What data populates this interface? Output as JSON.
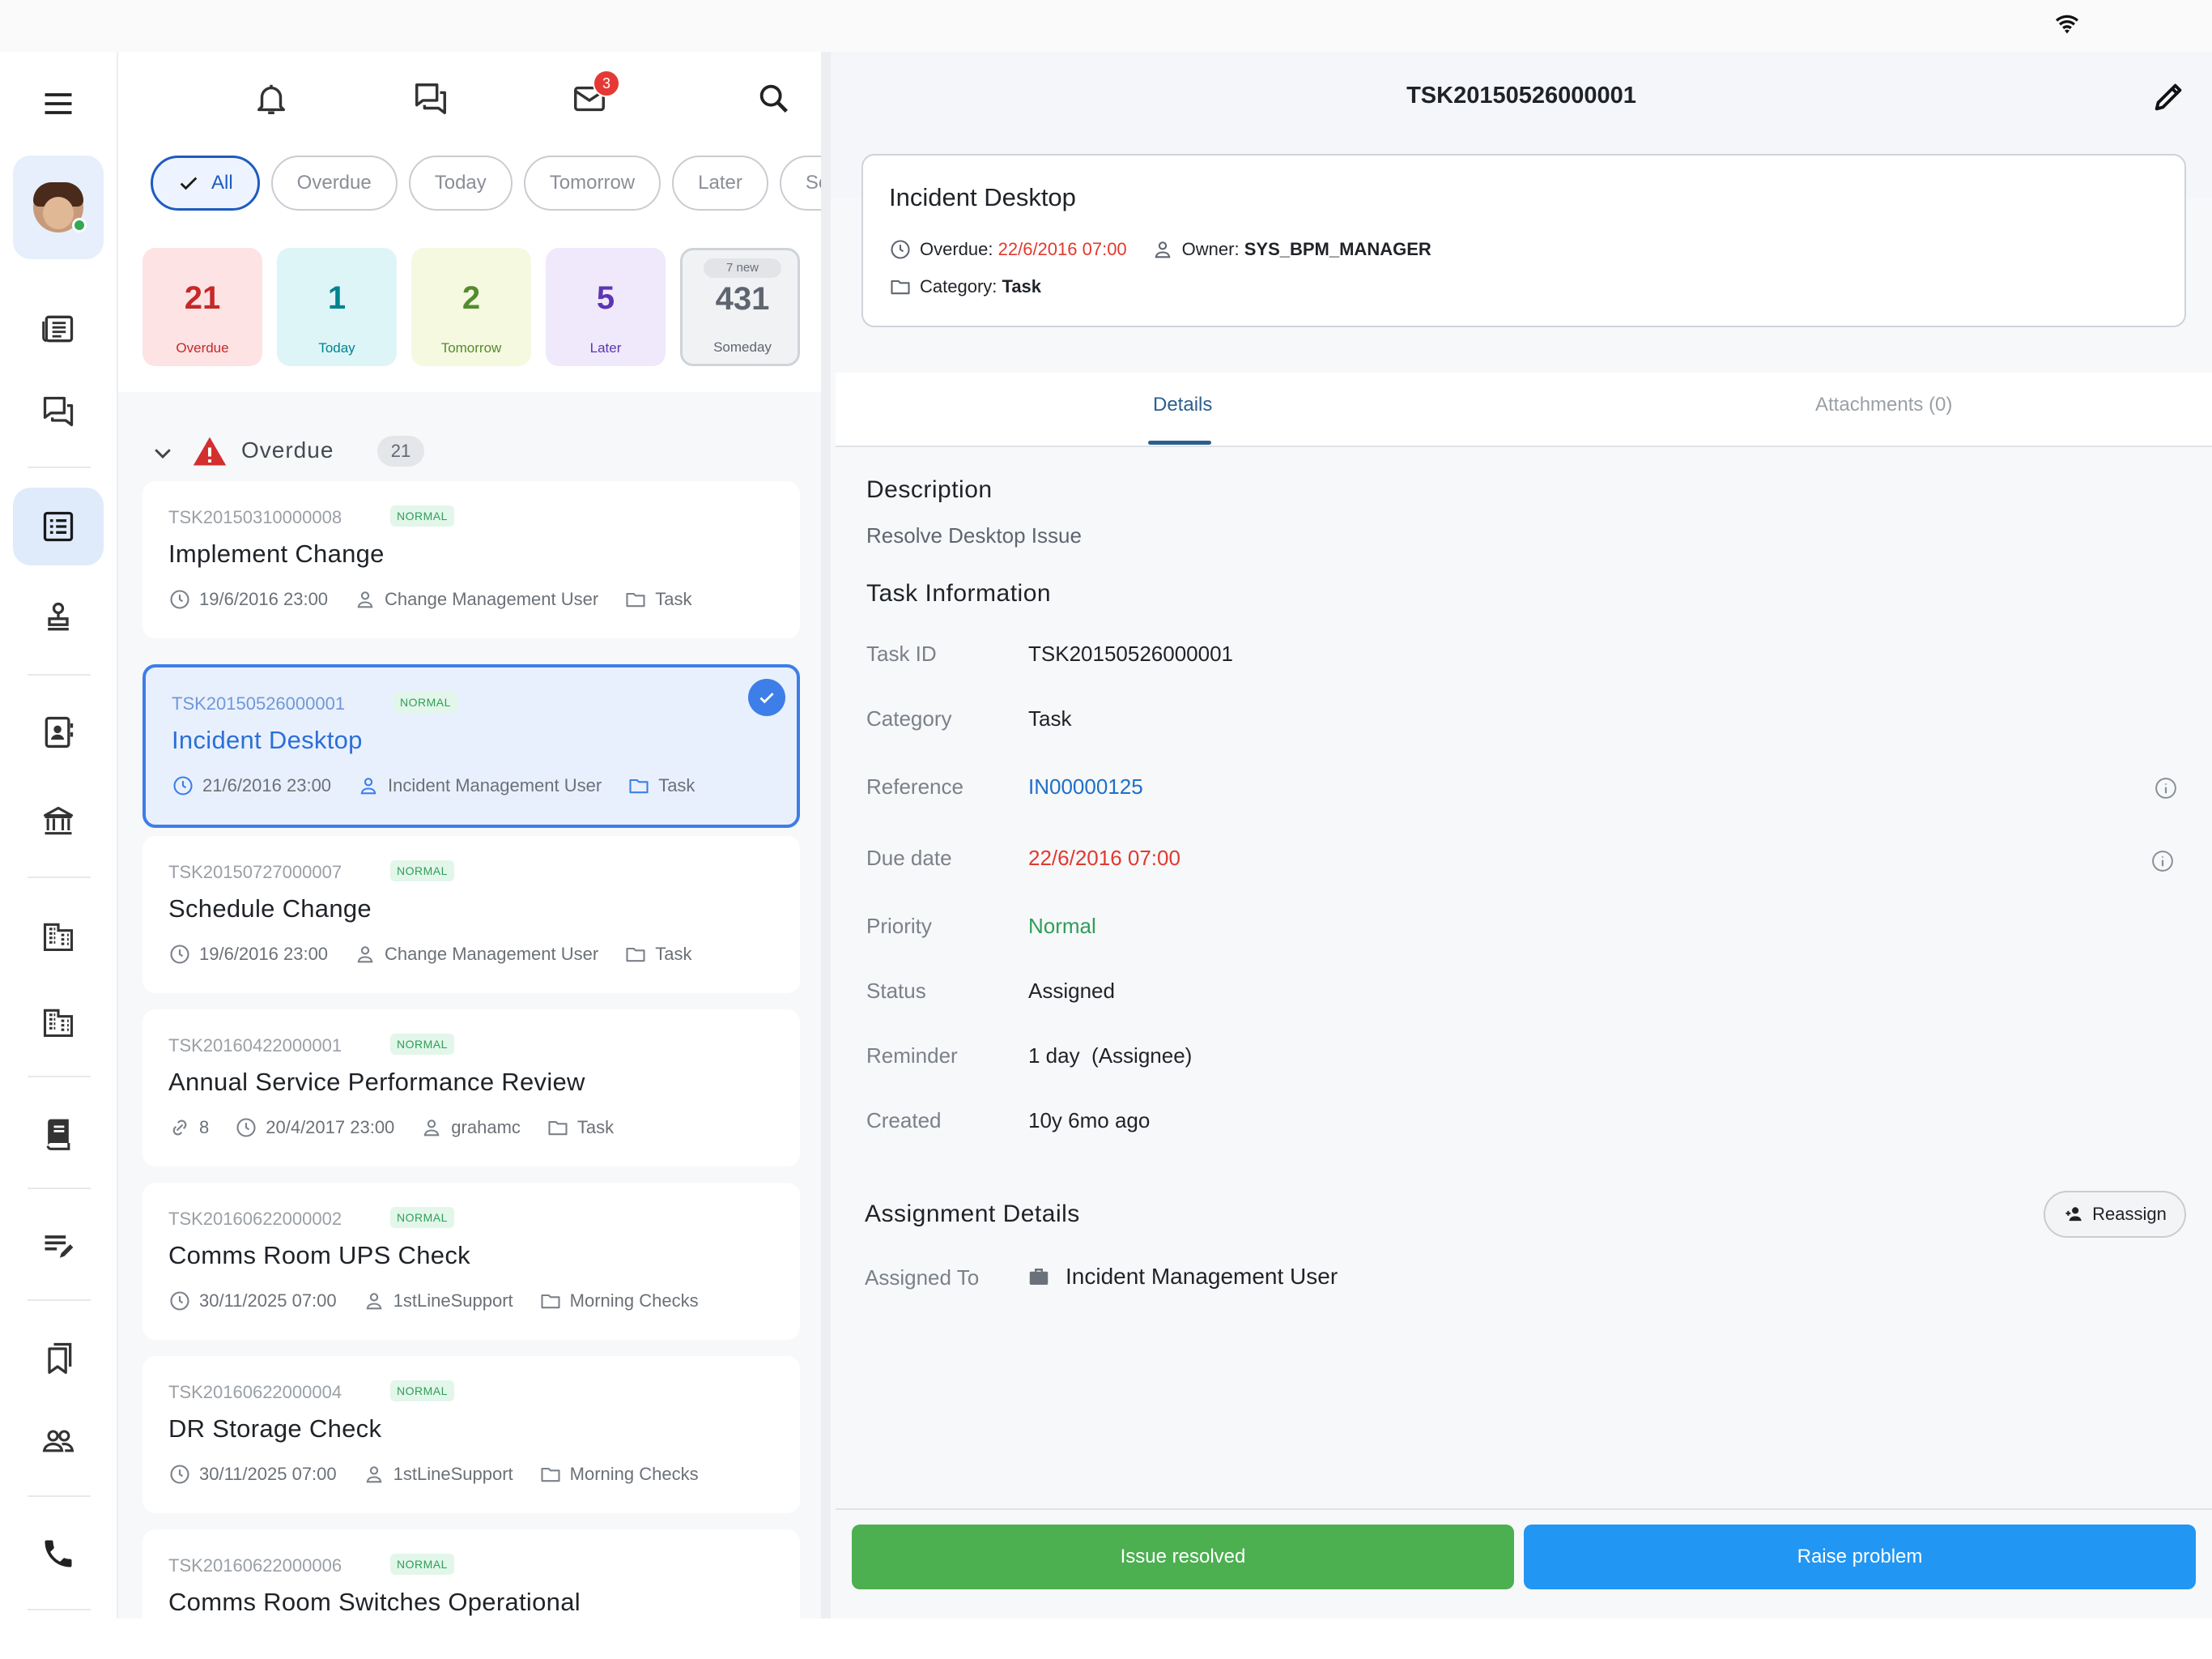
{
  "sidebar": {
    "menu_icon": "menu-icon",
    "items": [
      {
        "icon": "news-icon"
      },
      {
        "icon": "chat-icon"
      },
      {
        "icon": "tasks-icon",
        "active": true
      },
      {
        "icon": "stamp-icon"
      },
      {
        "icon": "contacts-icon"
      },
      {
        "icon": "bank-icon"
      },
      {
        "icon": "building-icon"
      },
      {
        "icon": "building-icon"
      },
      {
        "icon": "book-icon"
      },
      {
        "icon": "edit-list-icon"
      },
      {
        "icon": "bookmarks-icon"
      },
      {
        "icon": "people-icon"
      },
      {
        "icon": "phone-icon"
      }
    ]
  },
  "toolbar": {
    "mail_badge": "3"
  },
  "filters": {
    "chips": [
      "All",
      "Overdue",
      "Today",
      "Tomorrow",
      "Later",
      "Som"
    ],
    "active": "All"
  },
  "stats": [
    {
      "value": "21",
      "label": "Overdue",
      "bg": "#fde3e4",
      "color": "#c62828"
    },
    {
      "value": "1",
      "label": "Today",
      "bg": "#def5f8",
      "color": "#00838f"
    },
    {
      "value": "2",
      "label": "Tomorrow",
      "bg": "#f5f9e0",
      "color": "#558b2f"
    },
    {
      "value": "5",
      "label": "Later",
      "bg": "#efe9fb",
      "color": "#5e35b1"
    },
    {
      "value": "431",
      "label": "Someday",
      "badge": "7 new",
      "bg": "#f1f2f4",
      "color": "#5f6570"
    }
  ],
  "section": {
    "title": "Overdue",
    "count": "21"
  },
  "tasks": [
    {
      "id": "TSK20150310000008",
      "badge": "NORMAL",
      "title": "Implement Change",
      "date": "19/6/2016 23:00",
      "owner": "Change Management User",
      "category": "Task"
    },
    {
      "id": "TSK20150526000001",
      "badge": "NORMAL",
      "title": "Incident Desktop",
      "date": "21/6/2016 23:00",
      "owner": "Incident Management User",
      "category": "Task",
      "selected": true
    },
    {
      "id": "TSK20150727000007",
      "badge": "NORMAL",
      "title": "Schedule Change",
      "date": "19/6/2016 23:00",
      "owner": "Change Management User",
      "category": "Task"
    },
    {
      "id": "TSK20160422000001",
      "badge": "NORMAL",
      "title": "Annual Service Performance Review",
      "links": "8",
      "date": "20/4/2017 23:00",
      "owner": "grahamc",
      "category": "Task"
    },
    {
      "id": "TSK20160622000002",
      "badge": "NORMAL",
      "title": "Comms Room UPS Check",
      "date": "30/11/2025 07:00",
      "owner": "1stLineSupport",
      "category": "Morning Checks"
    },
    {
      "id": "TSK20160622000004",
      "badge": "NORMAL",
      "title": "DR Storage Check",
      "date": "30/11/2025 07:00",
      "owner": "1stLineSupport",
      "category": "Morning Checks"
    },
    {
      "id": "TSK20160622000006",
      "badge": "NORMAL",
      "title": "Comms Room Switches Operational"
    }
  ],
  "detail": {
    "header_id": "TSK20150526000001",
    "summary": {
      "title": "Incident Desktop",
      "overdue_label": "Overdue:",
      "overdue_value": "22/6/2016 07:00",
      "owner_label": "Owner:",
      "owner_value": "SYS_BPM_MANAGER",
      "category_label": "Category:",
      "category_value": "Task"
    },
    "tabs": [
      "Details",
      "Attachments (0)"
    ],
    "description_title": "Description",
    "description": "Resolve Desktop Issue",
    "info_title": "Task Information",
    "fields": [
      {
        "k": "Task ID",
        "v": "TSK20150526000001"
      },
      {
        "k": "Category",
        "v": "Task"
      },
      {
        "k": "Reference",
        "v": "IN00000125"
      },
      {
        "k": "Due date",
        "v": "22/6/2016 07:00"
      },
      {
        "k": "Priority",
        "v": "Normal"
      },
      {
        "k": "Status",
        "v": "Assigned"
      },
      {
        "k": "Reminder",
        "v": "1 day  (Assignee)"
      },
      {
        "k": "Created",
        "v": "10y 6mo ago"
      }
    ],
    "assignment_title": "Assignment Details",
    "reassign_label": "Reassign",
    "assigned_to_label": "Assigned To",
    "assigned_to_value": "Incident Management User"
  },
  "actions": {
    "resolve_label": "Issue resolved",
    "raise_label": "Raise problem"
  },
  "colors": {
    "accent": "#2c6fd8",
    "resolve": "#4caf50",
    "raise": "#2196f3",
    "danger": "#e03a2f"
  }
}
